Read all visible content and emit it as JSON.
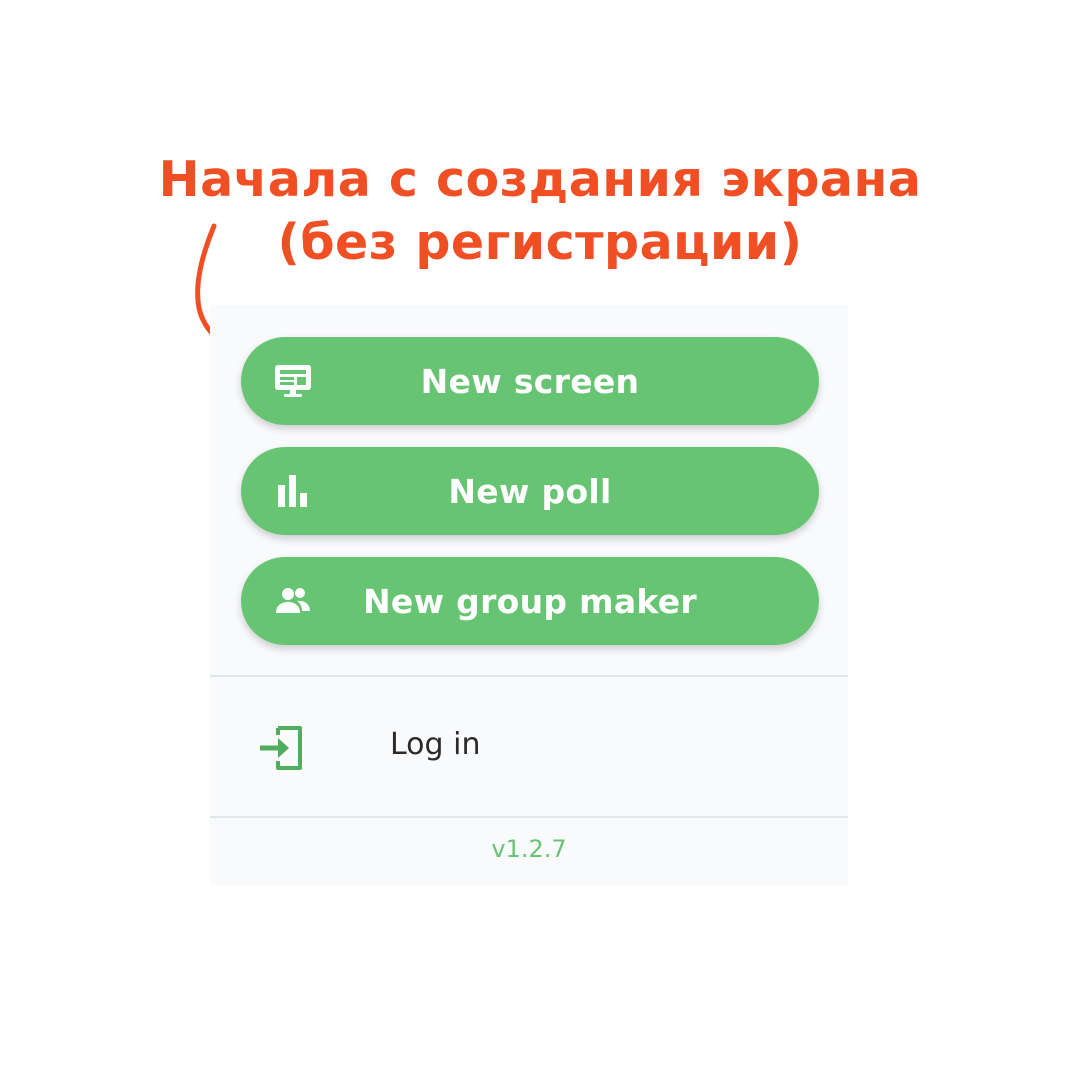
{
  "annotation": {
    "line1": "Начала с создания экрана",
    "line2": "(без регистрации)",
    "color": "#f04e23"
  },
  "menu": {
    "buttons": [
      {
        "label": "New screen",
        "icon": "monitor-icon"
      },
      {
        "label": "New poll",
        "icon": "bar-chart-icon"
      },
      {
        "label": "New group maker",
        "icon": "people-icon"
      }
    ],
    "login": {
      "label": "Log in",
      "icon": "login-icon"
    },
    "version": "v1.2.7",
    "accent_color": "#66c473"
  }
}
